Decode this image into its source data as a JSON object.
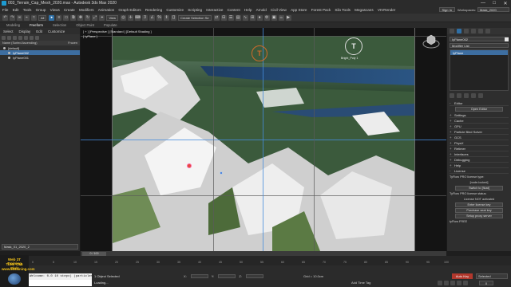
{
  "window": {
    "title": "003_Terrain_Cap_Mesh_2020.max - Autodesk 3ds Max 2020",
    "minimize": "—",
    "maximize": "□",
    "close": "✕"
  },
  "menu": {
    "items": [
      "File",
      "Edit",
      "Tools",
      "Group",
      "Views",
      "Create",
      "Modifiers",
      "Animation",
      "Graph Editors",
      "Rendering",
      "Customize",
      "Scripting",
      "Interactive",
      "Content",
      "Help",
      "Arnold",
      "Civil View",
      "App Store",
      "Forest Pack",
      "Silo Tools",
      "Megascans",
      "VIVRender"
    ],
    "sign_in": "Sign In",
    "workspaces_label": "Workspaces:",
    "workspace_value": "Mask_2020"
  },
  "toolbar": {
    "selection_filter": "All",
    "view_dropdown": "View",
    "create_selection_set": "Create Selection Se"
  },
  "ribbon": {
    "tabs": [
      "Modeling",
      "Freeform",
      "Selection",
      "Object Paint",
      "Populate"
    ],
    "active": "Freeform"
  },
  "scene_explorer": {
    "menu": [
      "Select",
      "Display",
      "Edit",
      "Customize"
    ],
    "header_name": "Name (Sorted Ascending)",
    "header_frozen": "Frozen",
    "rows": [
      {
        "label": "[default]",
        "level": 1,
        "selected": false
      },
      {
        "label": "IyPlane002",
        "level": 2,
        "selected": true
      },
      {
        "label": "IyPlane001",
        "level": 2,
        "selected": false
      }
    ],
    "layer_field": "Mask_01_2020_2"
  },
  "viewport": {
    "label": "[ + ] [Perspective ] [Standard ] [Default Shading ]",
    "sublabel": "[ IyPlane ]",
    "camera_label": "Bright_Poly 1"
  },
  "command_panel": {
    "object_name": "IyPlane002",
    "modifier_list": "Modifier List",
    "stack_item": "IyPlane",
    "rollouts": [
      {
        "label": "Editor",
        "sign": "-"
      },
      {
        "label": "Settings",
        "sign": "+"
      },
      {
        "label": "Cache",
        "sign": "+"
      },
      {
        "label": "GPU",
        "sign": "+"
      },
      {
        "label": "Particle Bind Solver",
        "sign": "+"
      },
      {
        "label": "GCS",
        "sign": "+"
      },
      {
        "label": "PhysX",
        "sign": "+"
      },
      {
        "label": "Retimer",
        "sign": "+"
      },
      {
        "label": "Interfaces",
        "sign": "+"
      },
      {
        "label": "Debugging",
        "sign": "+"
      },
      {
        "label": "Help",
        "sign": "+"
      },
      {
        "label": "License",
        "sign": "-"
      }
    ],
    "editor_button": "Open Editor",
    "license_type_label": "TyFlow PRO license type:",
    "license_type_value": "[node-locked]",
    "switch_button": "Switch to [float]",
    "license_status_label": "TyFlow PRO license status:",
    "license_status_value": "License NOT activated",
    "enter_key_button": "Enter license key",
    "purchase_button": "Purchase seat key",
    "proxy_button": "Setup proxy server",
    "free_label": "tyFlow FREE"
  },
  "timeline": {
    "slider": "0 / 100",
    "ticks": [
      "0",
      "5",
      "10",
      "15",
      "20",
      "25",
      "30",
      "35",
      "40",
      "45",
      "50",
      "55",
      "60",
      "65",
      "70",
      "75",
      "80",
      "85",
      "90",
      "95",
      "100"
    ]
  },
  "status": {
    "maxscript_line1": "Welcome: 0-0 10 stepx) (particles)",
    "maxscript_line2": "",
    "objects_selected": "1 Object Selected",
    "loading": "Loading...",
    "x_label": "X:",
    "y_label": "Y:",
    "z_label": "Z:",
    "grid": "Grid = 10.0cm",
    "add_time_tag": "Add Time Tag",
    "auto_key": "Auto Key",
    "selected": "Selected",
    "frame": "0"
  },
  "logo": {
    "line1": "Web 3T Training",
    "line2": "Tutor Cs6 Club",
    "line3": "www.3ttraining.com"
  },
  "colors": {
    "accent_blue": "#3d6ea1",
    "auto_key_red": "#b2382d",
    "grid_blue": "#468cdc",
    "camera_orange": "#d06b2b"
  }
}
